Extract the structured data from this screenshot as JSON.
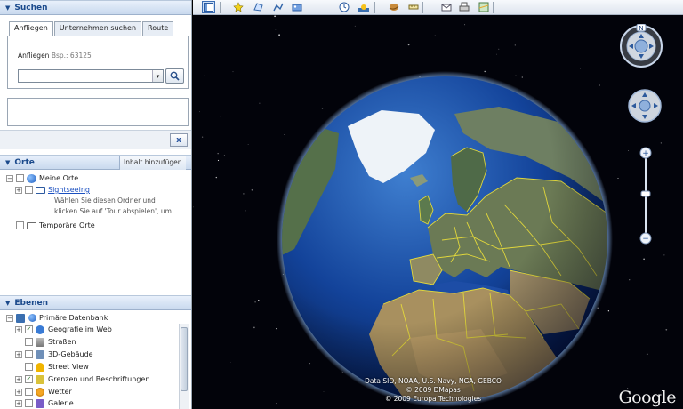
{
  "search": {
    "title": "Suchen",
    "tabs": [
      "Anfliegen",
      "Unternehmen suchen",
      "Route"
    ],
    "active_tab": "Anfliegen",
    "label": "Anfliegen",
    "hint": "Bsp.: 63125",
    "query_value": "",
    "clear_label": "x"
  },
  "places": {
    "title": "Orte",
    "add_content_label": "Inhalt hinzufügen",
    "items": [
      {
        "label": "Meine Orte",
        "expanded": true
      },
      {
        "label": "Sightseeing",
        "link": true
      },
      {
        "label": "Temporäre Orte"
      }
    ],
    "sightseeing_desc_1": "Wählen Sie diesen Ordner und",
    "sightseeing_desc_2": "klicken Sie auf 'Tour abspielen', um"
  },
  "layers": {
    "title": "Ebenen",
    "root": "Primäre Datenbank",
    "items": [
      {
        "label": "Geografie im Web",
        "checked": true,
        "icon": "web-icon",
        "color": "#3a7bd5"
      },
      {
        "label": "Straßen",
        "checked": false,
        "icon": "road-icon",
        "color": "#888888"
      },
      {
        "label": "3D-Gebäude",
        "checked": false,
        "icon": "building-icon",
        "color": "#6f8fb8"
      },
      {
        "label": "Street View",
        "checked": false,
        "icon": "streetview-icon",
        "color": "#f0b400"
      },
      {
        "label": "Grenzen und Beschriftungen",
        "checked": true,
        "icon": "borders-icon",
        "color": "#d9c23a"
      },
      {
        "label": "Wetter",
        "checked": false,
        "icon": "weather-icon",
        "color": "#f5a623"
      },
      {
        "label": "Galerie",
        "checked": false,
        "icon": "gallery-icon",
        "color": "#7a5cc7"
      }
    ]
  },
  "toolbar": {
    "buttons": [
      "sidebar-toggle-icon",
      "placemark-icon",
      "polygon-icon",
      "path-icon",
      "overlay-icon",
      "history-icon",
      "sun-icon",
      "planets-icon",
      "ruler-icon",
      "email-icon",
      "print-icon",
      "map-view-icon"
    ]
  },
  "map": {
    "attribution_1": "Data SIO, NOAA, U.S. Navy, NGA, GEBCO",
    "attribution_2": "© 2009 DMapas",
    "attribution_3": "© 2009 Europa Technologies",
    "logo": "Google",
    "compass_letter": "N"
  }
}
